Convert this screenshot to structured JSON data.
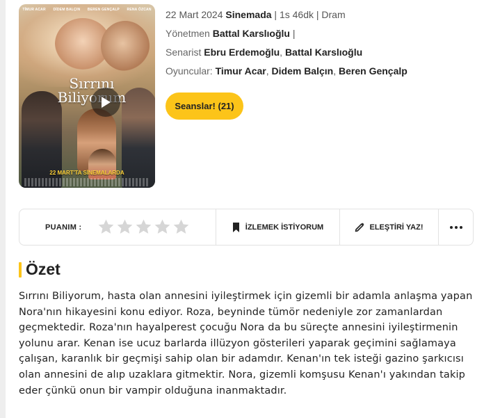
{
  "poster": {
    "cast_names": [
      "TİMUR ACAR",
      "DİDEM BALÇIN",
      "BEREN GENÇALP",
      "RENA ÖZCAN"
    ],
    "title": "Sırrını Biliyorum",
    "release_line": "22 MART'TA SİNEMALARDA"
  },
  "meta": {
    "date": "22 Mart 2024",
    "status": "Sinemada",
    "duration": "| 1s 46dk |",
    "genre": "Dram",
    "director_label": "Yönetmen",
    "director": "Battal Karslıoğlu",
    "director_sep": "|",
    "writer_label": "Senarist",
    "writers": [
      "Ebru Erdemoğlu",
      "Battal Karslıoğlu"
    ],
    "cast_label": "Oyuncular:",
    "cast": [
      "Timur Acar",
      "Didem Balçın",
      "Beren Gençalp"
    ],
    "comma": ","
  },
  "sessions_button": "Seanslar! (21)",
  "actions": {
    "rating_label": "PUANIM :",
    "star_count": 5,
    "rating_value": 0,
    "watchlist_label": "İZLEMEK İSTİYORUM",
    "review_label": "ELEŞTİRİ YAZ!"
  },
  "summary": {
    "title": "Özet",
    "text": "Sırrını Biliyorum, hasta olan annesini iyileştirmek için gizemli bir adamla anlaşma yapan Nora'nın hikayesini konu ediyor. Roza, beyninde tümör nedeniyle zor zamanlardan geçmektedir. Roza'nın hayalperest çocuğu Nora da bu süreçte annesini iyileştirmenin yolunu arar. Kenan ise ucuz barlarda illüzyon gösterileri yaparak geçimini sağlamaya çalışan, karanlık bir geçmişi sahip olan bir adamdır. Kenan'ın tek isteği gazino şarkıcısı olan annesini de alıp uzaklara gitmektir. Nora, gizemli komşusu Kenan'ı yakından takip eder çünkü onun bir vampir olduğuna inanmaktadır."
  },
  "colors": {
    "accent": "#fcc419",
    "star_empty": "#d6d6d6"
  }
}
